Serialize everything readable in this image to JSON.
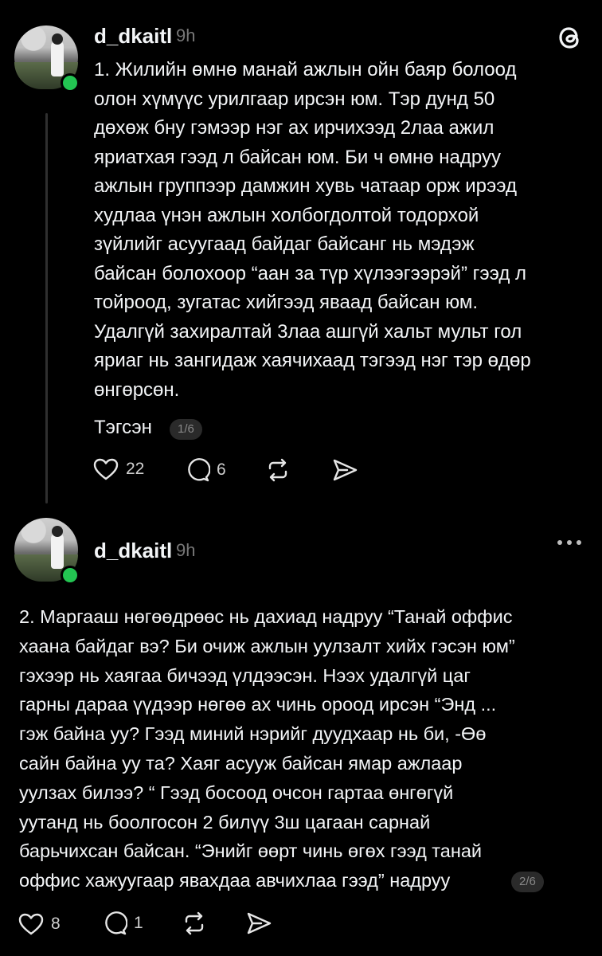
{
  "app": {
    "logo_icon": "threads-logo-icon"
  },
  "posts": [
    {
      "username": "d_dkaitl",
      "time": "9h",
      "text": "1. Жилийн өмнө манай ажлын ойн баяр болоод\nолон хүмүүс урилгаар ирсэн юм. Тэр дунд 50\nдөхөж бну гэмээр нэг ах ирчихээд 2лаа ажил\nяриатхая гээд л байсан юм. Би ч өмнө надруу\nажлын группээр дамжин хувь чатаар орж ирээд\nхудлаа үнэн ажлын холбогдолтой тодорхой\nзүйлийг асуугаад байдаг байсанг нь мэдэж\nбайсан болохоор “аан за түр хүлээгээрэй” гээд л\nтойроод, зугатас хийгээд яваад байсан юм.\nУдалгүй захиралтай 3лаа ашгүй хальт мульт гол\nяриаг нь зангидаж хаячихаад тэгээд нэг тэр өдөр\nөнгөрсөн.",
      "continuation": "Тэгсэн",
      "page": "1/6",
      "likes": "22",
      "replies": "6"
    },
    {
      "username": "d_dkaitl",
      "time": "9h",
      "text": "2. Маргааш нөгөөдрөөс нь дахиад надруу “Танай оффис\nхаана байдаг вэ? Би очиж ажлын уулзалт хийх гэсэн юм”\nгэхээр нь хаягаа бичээд үлдээсэн. Нээх удалгүй цаг\nгарны дараа үүдээр нөгөө ах чинь ороод ирсэн “Энд ...\nгэж байна уу? Гээд миний нэрийг дуудхаар нь би, -Өө\nсайн байна уу та? Хаяг асууж байсан ямар ажлаар\nуулзах билээ? “ Гээд босоод очсон гартаа өнгөгүй\nуутанд нь боолгосон 2 билүү 3ш цагаан сарнай\nбарьчихсан байсан. “Энийг өөрт чинь өгөх гээд танай",
      "last_line": "оффис хажуугаар явахдаа авчихлаа гээд” надруу",
      "page": "2/6",
      "likes": "8",
      "replies": "1"
    }
  ],
  "icons": {
    "like": "heart-icon",
    "reply": "comment-icon",
    "repost": "repost-icon",
    "share": "share-icon",
    "more": "more-dots-icon"
  },
  "colors": {
    "online": "#23c552",
    "background": "#000000",
    "text": "#f3f5f7",
    "muted": "#777777"
  }
}
